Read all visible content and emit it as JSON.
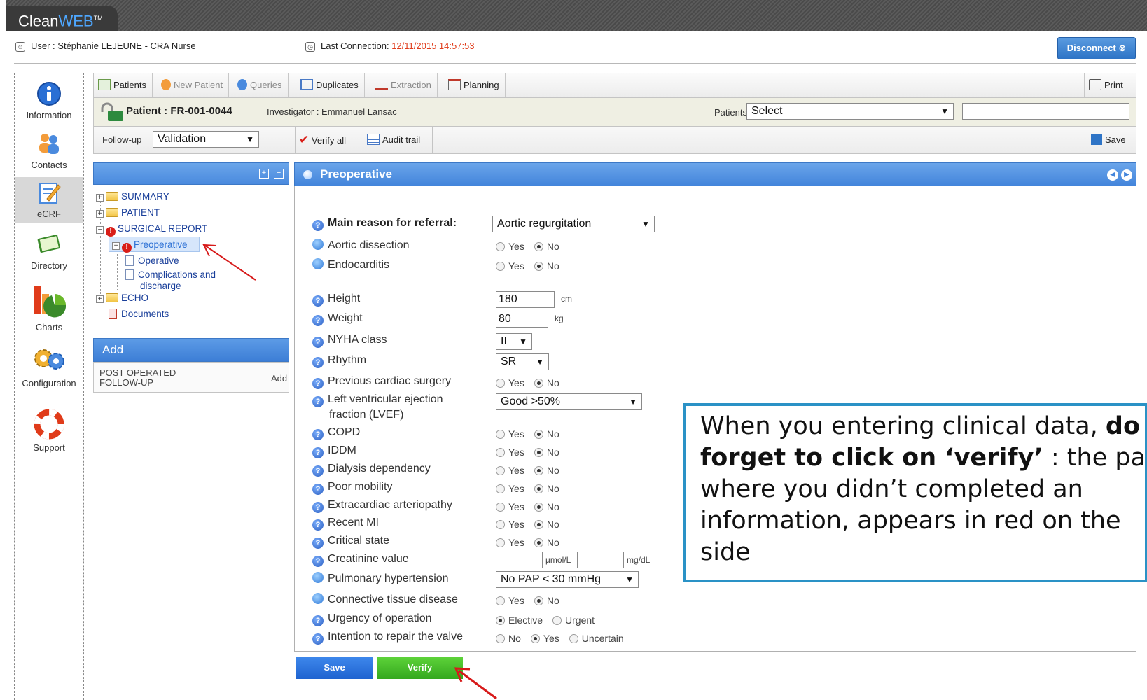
{
  "app": {
    "brand_clean": "Clean",
    "brand_web": "WEB",
    "brand_tm": "TM"
  },
  "header": {
    "user_label": "User :",
    "user_name": "Stéphanie LEJEUNE - CRA Nurse",
    "last_connection_label": "Last Connection:",
    "last_connection_value": "12/11/2015 14:57:53",
    "disconnect": "Disconnect"
  },
  "nav": {
    "information": "Information",
    "contacts": "Contacts",
    "ecrf": "eCRF",
    "directory": "Directory",
    "charts": "Charts",
    "configuration": "Configuration",
    "support": "Support"
  },
  "toolbar": {
    "patients": "Patients",
    "new_patient": "New Patient",
    "queries": "Queries",
    "duplicates": "Duplicates",
    "extraction": "Extraction",
    "planning": "Planning",
    "print": "Print"
  },
  "patient_bar": {
    "patient": "Patient : FR-001-0044",
    "investigator": "Investigator : Emmanuel Lansac",
    "patients_label": "Patients",
    "patients_select": "Select",
    "search_value": ""
  },
  "followup_bar": {
    "label": "Follow-up",
    "value": "Validation",
    "verify_all": "Verify all",
    "audit_trail": "Audit trail",
    "save": "Save"
  },
  "tree": {
    "summary": "SUMMARY",
    "patient": "PATIENT",
    "surgical_report": "SURGICAL REPORT",
    "preoperative": "Preoperative",
    "operative": "Operative",
    "complications_1": "Complications and",
    "complications_2": "discharge",
    "echo": "ECHO",
    "documents": "Documents"
  },
  "add_panel": {
    "title": "Add",
    "item_1": "POST OPERATED",
    "item_2": "FOLLOW-UP",
    "add_link": "Add"
  },
  "form": {
    "title": "Preoperative",
    "main_reason_label": "Main reason for referral:",
    "main_reason_value": "Aortic regurgitation",
    "aortic_dissection": "Aortic dissection",
    "endocarditis": "Endocarditis",
    "height_label": "Height",
    "height_value": "180",
    "height_unit": "cm",
    "weight_label": "Weight",
    "weight_value": "80",
    "weight_unit": "kg",
    "nyha_label": "NYHA class",
    "nyha_value": "II",
    "rhythm_label": "Rhythm",
    "rhythm_value": "SR",
    "previous_surgery": "Previous cardiac surgery",
    "lvef_label_1": "Left ventricular ejection",
    "lvef_label_2": "fraction (LVEF)",
    "lvef_value": "Good >50%",
    "copd": "COPD",
    "iddm": "IDDM",
    "dialysis": "Dialysis dependency",
    "poor_mobility": "Poor mobility",
    "extracardiac": "Extracardiac arteriopathy",
    "recent_mi": "Recent MI",
    "critical_state": "Critical state",
    "creatinine_label": "Creatinine value",
    "creatinine_unit_1": "µmol/L",
    "creatinine_unit_2": "mg/dL",
    "pulmonary_label": "Pulmonary hypertension",
    "pulmonary_value": "No PAP < 30 mmHg",
    "connective": "Connective tissue disease",
    "urgency_label": "Urgency of operation",
    "intention_label": "Intention to repair the valve",
    "yes": "Yes",
    "no": "No",
    "elective": "Elective",
    "urgent": "Urgent",
    "uncertain": "Uncertain"
  },
  "buttons": {
    "save": "Save",
    "verify": "Verify"
  },
  "callout": {
    "line1_a": "When you entering clinical data, ",
    "line1_b": "do",
    "line2_a": "forget to click on ‘verify’",
    "line2_b": " : the part",
    "line3": "where you didn’t completed an",
    "line4": "information, appears in red on the",
    "line5": "side"
  },
  "colors": {
    "accent_blue": "#4a8ade",
    "verify_green": "#34a81e",
    "error_red": "#d91e18",
    "arrow_red": "#d71a1a"
  }
}
